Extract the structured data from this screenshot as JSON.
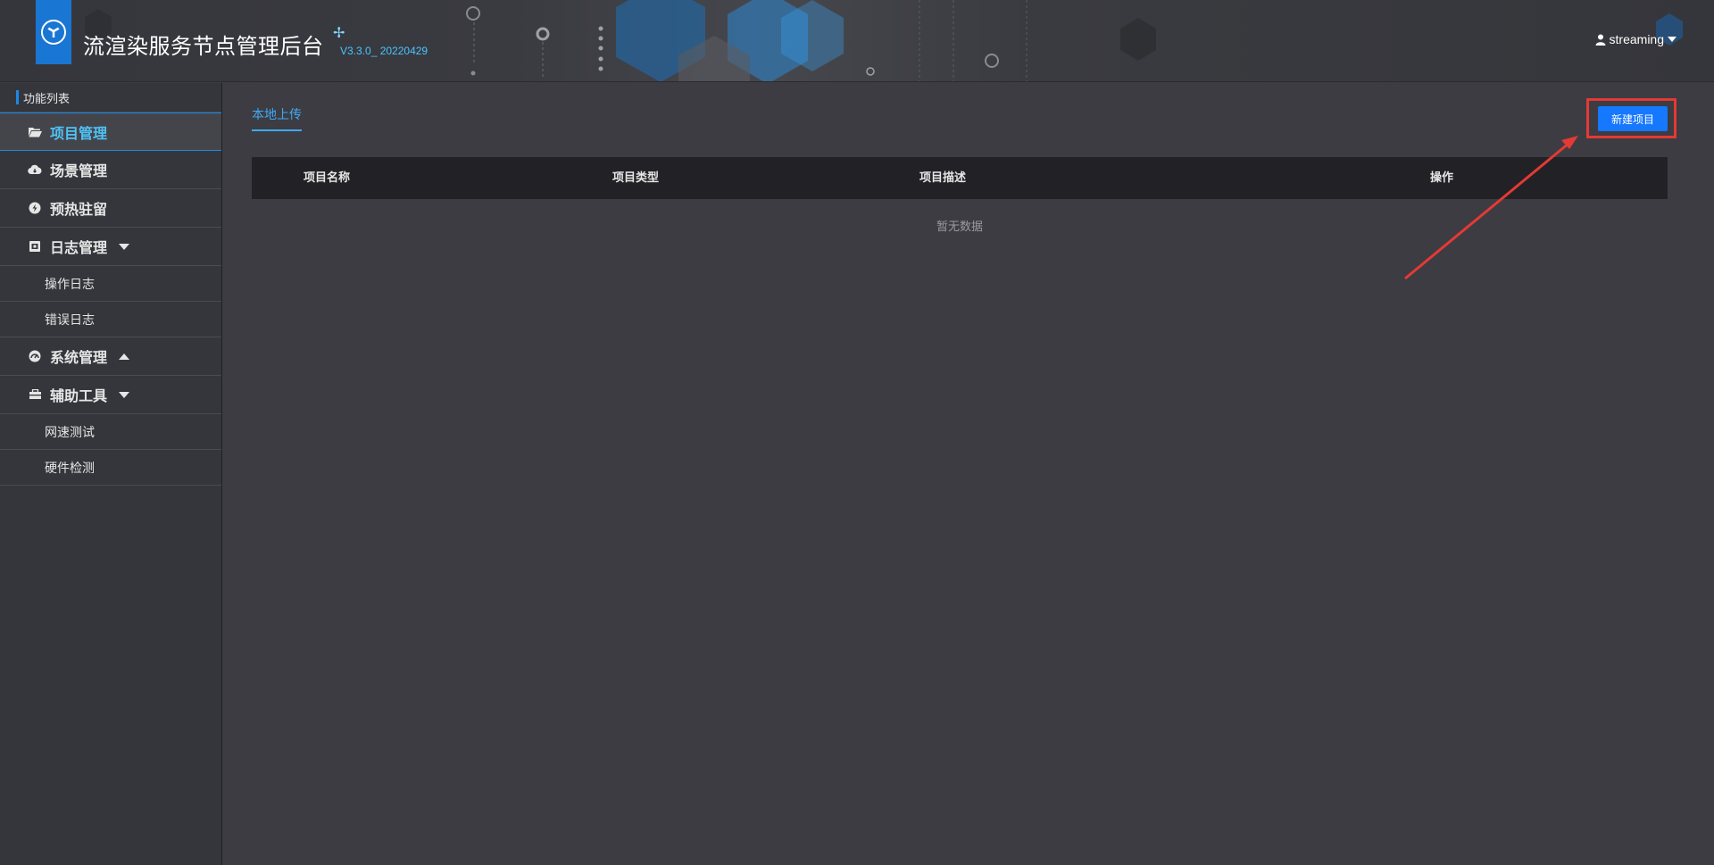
{
  "header": {
    "title": "流渲染服务节点管理后台",
    "version": "V3.3.0_ 20220429",
    "user": "streaming",
    "icons": {
      "logo": "cube-logo-icon",
      "sparkle": "sparkle-icon",
      "user": "user-icon"
    }
  },
  "sidebar": {
    "title": "功能列表",
    "items": [
      {
        "label": "项目管理",
        "icon": "folder-open-icon",
        "active": true
      },
      {
        "label": "场景管理",
        "icon": "cloud-icon"
      },
      {
        "label": "预热驻留",
        "icon": "bolt-icon"
      },
      {
        "label": "日志管理",
        "icon": "log-box-icon",
        "expanded": true,
        "children": [
          {
            "label": "操作日志"
          },
          {
            "label": "错误日志"
          }
        ]
      },
      {
        "label": "系统管理",
        "icon": "gauge-icon",
        "expanded": false
      },
      {
        "label": "辅助工具",
        "icon": "toolbox-icon",
        "expanded": true,
        "children": [
          {
            "label": "网速测试"
          },
          {
            "label": "硬件检测"
          }
        ]
      }
    ]
  },
  "main": {
    "tab": "本地上传",
    "new_button": "新建项目",
    "table": {
      "columns": [
        "项目名称",
        "项目类型",
        "项目描述",
        "操作"
      ],
      "empty_text": "暂无数据"
    }
  },
  "colors": {
    "accent": "#1677ff",
    "active_text": "#4fc3f7",
    "highlight": "#e53935",
    "background": "#3c3c42",
    "sidebar": "#35363b"
  }
}
